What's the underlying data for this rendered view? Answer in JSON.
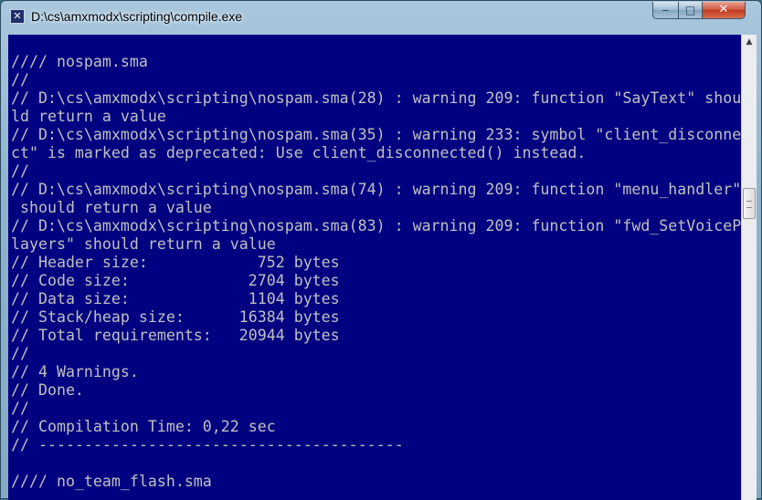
{
  "window": {
    "title": "D:\\cs\\amxmodx\\scripting\\compile.exe",
    "icon": "cmd-icon",
    "buttons": {
      "minimize": "minimize-icon",
      "maximize": "maximize-icon",
      "close": "close-icon"
    }
  },
  "colors": {
    "console_background": "#000080",
    "console_text": "#c0c0c0"
  },
  "console": {
    "lines": [
      "//// nospam.sma",
      "//",
      "// D:\\cs\\amxmodx\\scripting\\nospam.sma(28) : warning 209: function \"SayText\" shou",
      "ld return a value",
      "// D:\\cs\\amxmodx\\scripting\\nospam.sma(35) : warning 233: symbol \"client_disconne",
      "ct\" is marked as deprecated: Use client_disconnected() instead.",
      "//",
      "// D:\\cs\\amxmodx\\scripting\\nospam.sma(74) : warning 209: function \"menu_handler\"",
      " should return a value",
      "// D:\\cs\\amxmodx\\scripting\\nospam.sma(83) : warning 209: function \"fwd_SetVoiceP",
      "layers\" should return a value",
      "// Header size:            752 bytes",
      "// Code size:             2704 bytes",
      "// Data size:             1104 bytes",
      "// Stack/heap size:      16384 bytes",
      "// Total requirements:   20944 bytes",
      "//",
      "// 4 Warnings.",
      "// Done.",
      "//",
      "// Compilation Time: 0,22 sec",
      "// ----------------------------------------",
      "",
      "//// no_team_flash.sma"
    ]
  }
}
